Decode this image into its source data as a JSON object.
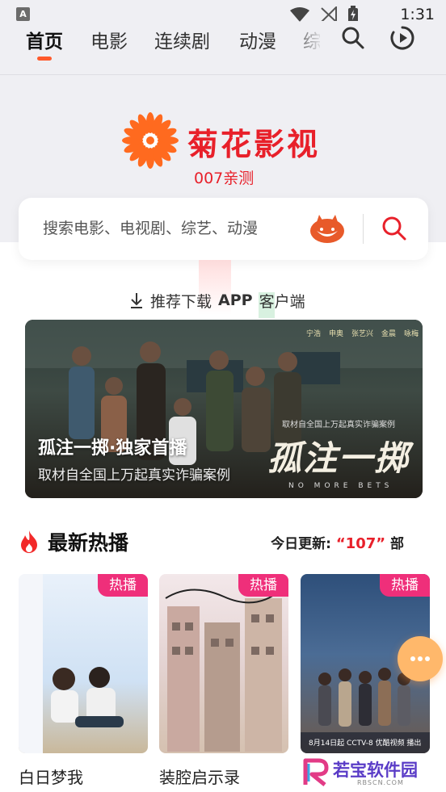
{
  "status_bar": {
    "time": "1:31",
    "notification_icon": "A"
  },
  "nav": {
    "tabs": [
      {
        "label": "首页",
        "active": true
      },
      {
        "label": "电影",
        "active": false
      },
      {
        "label": "连续剧",
        "active": false
      },
      {
        "label": "动漫",
        "active": false
      },
      {
        "label": "综",
        "active": false
      }
    ],
    "search_icon": "search-icon",
    "history_icon": "play-history-icon",
    "accent_color": "#ff5a2c"
  },
  "brand": {
    "name": "菊花影视",
    "tagline": "007亲测",
    "color": "#e8202a"
  },
  "search": {
    "placeholder": "搜索电影、电视剧、综艺、动漫"
  },
  "download": {
    "prefix": "推荐下载",
    "app": "APP",
    "suffix": "客户端"
  },
  "banner": {
    "title": "孤注一掷·独家首播",
    "subtitle": "取材自全国上万起真实诈骗案例",
    "poster_title": "孤注一掷",
    "poster_caption": "取材自全国上万起真实诈骗案例",
    "poster_english": "NO MORE BETS",
    "credits": [
      "宁浩",
      "申奥",
      "张艺兴",
      "金晨",
      "咏梅"
    ]
  },
  "section": {
    "title": "最新热播",
    "update_label": "今日更新:",
    "update_count": "“107”",
    "update_unit": "部"
  },
  "cards": [
    {
      "title": "白日梦我",
      "badge": "热播"
    },
    {
      "title": "装腔启示录",
      "badge": "热播"
    },
    {
      "title": "",
      "badge": "热播",
      "poster_text": "8月14日起 CCTV-8 优酷视频 播出"
    }
  ],
  "watermark": {
    "text": "若宝软件园",
    "sub": "RBSCN.COM"
  }
}
